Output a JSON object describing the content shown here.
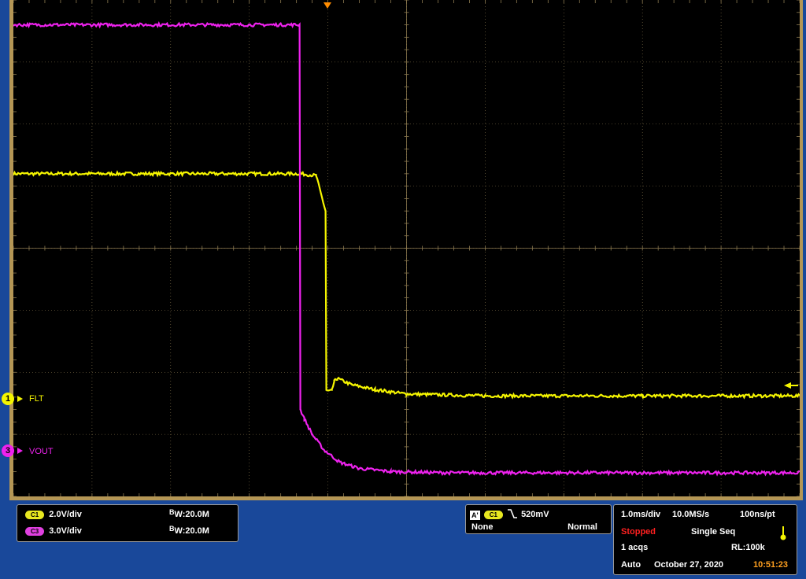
{
  "channels": [
    {
      "id": "1",
      "name": "FLT",
      "color": "#f5f500"
    },
    {
      "id": "3",
      "name": "VOUT",
      "color": "#ee22ee"
    }
  ],
  "vertical": [
    {
      "pill": "C1",
      "scale": "2.0V/div",
      "bw_prefix": "B",
      "bw_sub": "W",
      "bw_value": ":20.0M",
      "color": "#e8e820"
    },
    {
      "pill": "C3",
      "scale": "3.0V/div",
      "bw_prefix": "B",
      "bw_sub": "W",
      "bw_value": ":20.0M",
      "color": "#e040e0"
    }
  ],
  "trigger": {
    "badge": "A'",
    "source": "C1",
    "slope_icon": "falling-edge-icon",
    "level": "520mV",
    "coupling": "None",
    "mode": "Normal"
  },
  "acquisition": {
    "timebase": "1.0ms/div",
    "sample_rate": "10.0MS/s",
    "resolution": "100ns/pt",
    "state": "Stopped",
    "sequence": "Single Seq",
    "acqs": "1 acqs",
    "record_length": "RL:100k",
    "trigger_mode": "Auto",
    "date": "October 27, 2020",
    "time": "10:51:23"
  },
  "colors": {
    "grid": "#8c7a50",
    "state_red": "#ff2020",
    "time_orange": "#ffa020",
    "ch1": "#f5f500",
    "ch3": "#ee22ee"
  },
  "chart_data": {
    "type": "line",
    "xlabel": "",
    "ylabel": "",
    "xlim": [
      0,
      10
    ],
    "ylim": [
      -4,
      4
    ],
    "grid": true,
    "series": [
      {
        "name": "FLT",
        "points": [
          [
            0,
            1.2
          ],
          [
            3.65,
            1.2
          ],
          [
            3.85,
            1.17
          ],
          [
            3.97,
            0.6
          ],
          [
            3.98,
            -2.3
          ],
          [
            4.05,
            -2.3
          ],
          [
            4.08,
            -2.15
          ],
          [
            4.12,
            -2.1
          ],
          [
            4.3,
            -2.2
          ],
          [
            4.6,
            -2.28
          ],
          [
            5,
            -2.35
          ],
          [
            6,
            -2.38
          ],
          [
            8,
            -2.38
          ],
          [
            10,
            -2.38
          ]
        ]
      },
      {
        "name": "VOUT",
        "points": [
          [
            0,
            3.6
          ],
          [
            3.64,
            3.6
          ],
          [
            3.65,
            -2.6
          ],
          [
            3.7,
            -2.75
          ],
          [
            3.8,
            -3.0
          ],
          [
            3.95,
            -3.25
          ],
          [
            4.15,
            -3.45
          ],
          [
            4.4,
            -3.55
          ],
          [
            4.8,
            -3.6
          ],
          [
            5.5,
            -3.62
          ],
          [
            10,
            -3.62
          ]
        ]
      }
    ]
  }
}
